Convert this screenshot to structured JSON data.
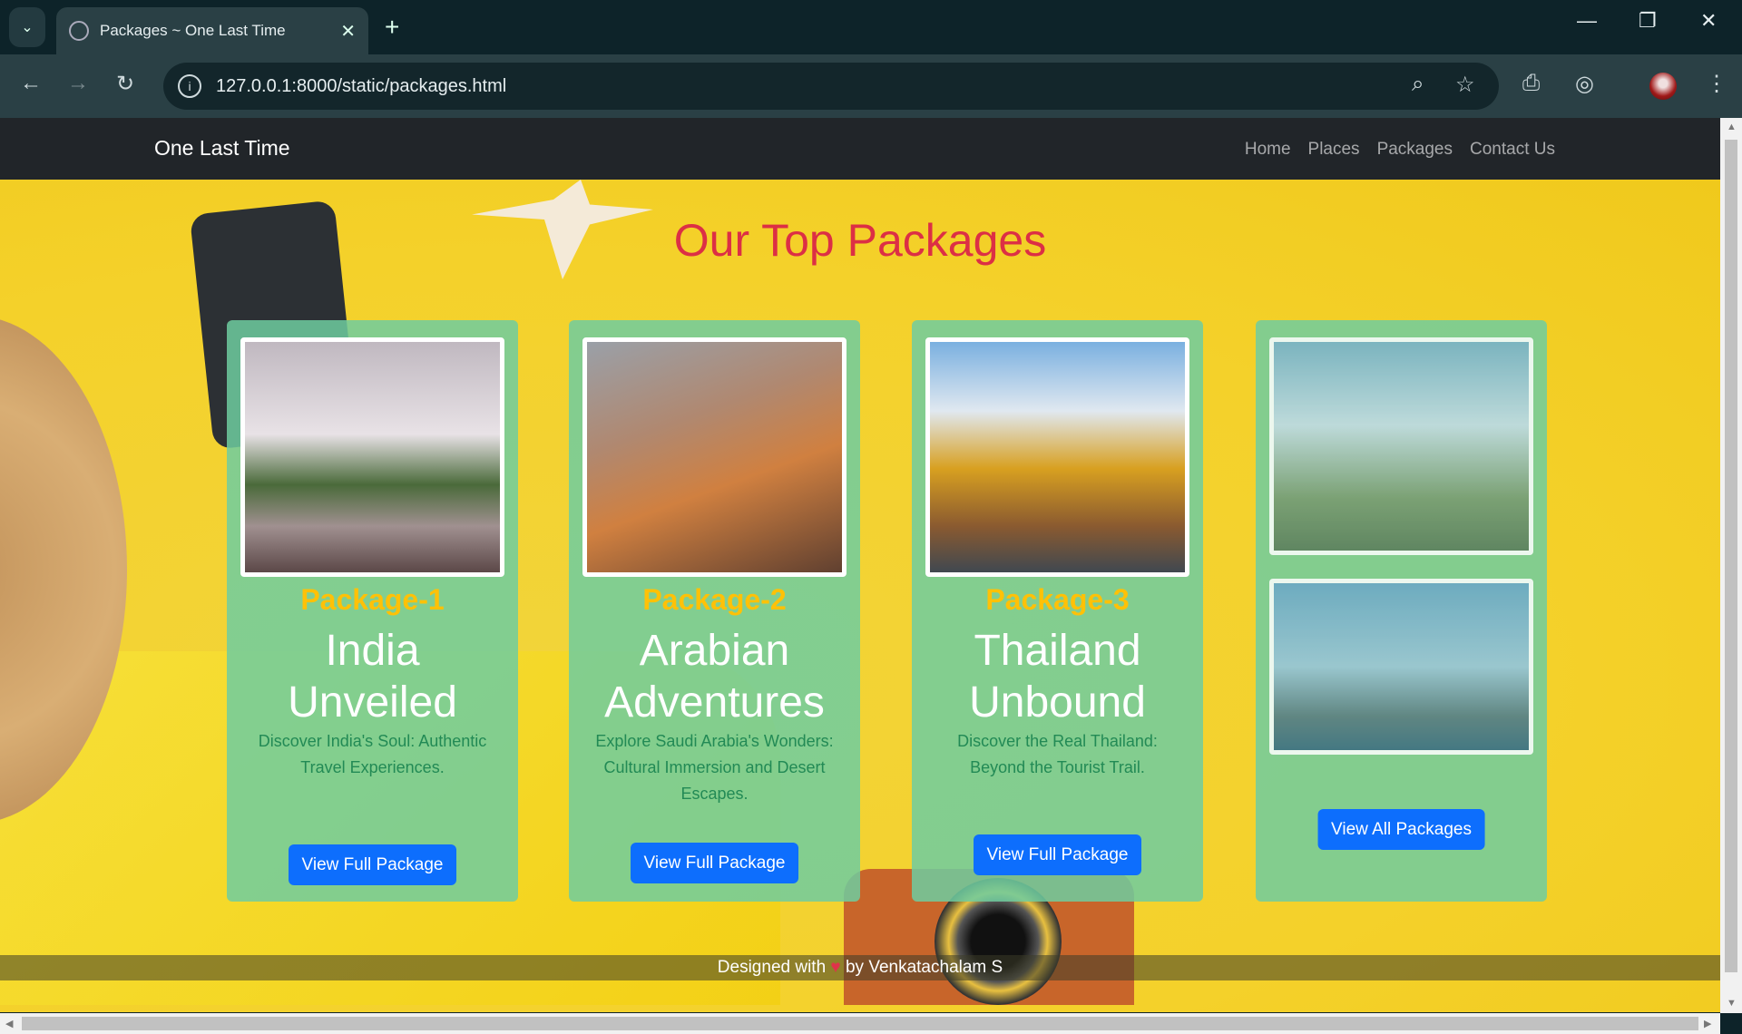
{
  "browser": {
    "tab_title": "Packages ~ One Last Time",
    "url": "127.0.0.1:8000/static/packages.html"
  },
  "navbar": {
    "brand": "One Last Time",
    "links": [
      "Home",
      "Places",
      "Packages",
      "Contact Us"
    ]
  },
  "main": {
    "title": "Our Top Packages",
    "packages": [
      {
        "label": "Package-1",
        "name": "India Unveiled",
        "description": "Discover India's Soul: Authentic Travel Experiences.",
        "button": "View Full Package"
      },
      {
        "label": "Package-2",
        "name": "Arabian Adventures",
        "description": "Explore Saudi Arabia's Wonders: Cultural Immersion and Desert Escapes.",
        "button": "View Full Package"
      },
      {
        "label": "Package-3",
        "name": "Thailand Unbound",
        "description": "Discover the Real Thailand: Beyond the Tourist Trail.",
        "button": "View Full Package"
      }
    ],
    "view_all": "View All Packages"
  },
  "footer": {
    "prefix": "Designed with",
    "suffix": "by Venkatachalam S"
  },
  "colors": {
    "accent": "#0d6efd",
    "title": "#dc2f45",
    "package_label": "#ffc107",
    "card": "#6ecda0"
  }
}
